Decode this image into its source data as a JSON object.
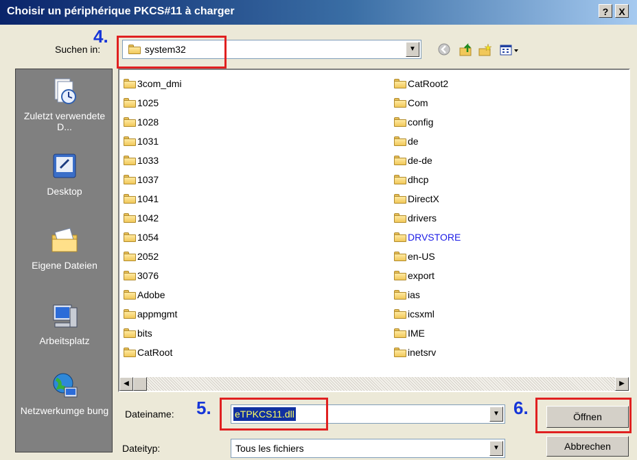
{
  "window": {
    "title": "Choisir un périphérique PKCS#11 à charger",
    "help_button": "?",
    "close_button": "X"
  },
  "lookin": {
    "label": "Suchen in:",
    "value": "system32"
  },
  "steps": {
    "step4": "4.",
    "step5": "5.",
    "step6": "6."
  },
  "toolbar_icons": [
    "back-icon",
    "up-folder-icon",
    "new-folder-icon",
    "view-menu-icon"
  ],
  "places": [
    {
      "label": "Zuletzt verwendete D...",
      "icon": "recent-documents-icon"
    },
    {
      "label": "Desktop",
      "icon": "desktop-icon"
    },
    {
      "label": "Eigene Dateien",
      "icon": "my-documents-icon"
    },
    {
      "label": "Arbeitsplatz",
      "icon": "my-computer-icon"
    },
    {
      "label": "Netzwerkumge bung",
      "icon": "network-places-icon"
    }
  ],
  "files": {
    "col1": [
      "3com_dmi",
      "1025",
      "1028",
      "1031",
      "1033",
      "1037",
      "1041",
      "1042",
      "1054",
      "2052",
      "3076",
      "Adobe",
      "appmgmt",
      "bits",
      "CatRoot"
    ],
    "col2": [
      "CatRoot2",
      "Com",
      "config",
      "de",
      "de-de",
      "dhcp",
      "DirectX",
      "drivers",
      "DRVSTORE",
      "en-US",
      "export",
      "ias",
      "icsxml",
      "IME",
      "inetsrv"
    ],
    "highlighted_item": "DRVSTORE",
    "highlight_color": "#1A1AE6"
  },
  "filename": {
    "label": "Dateiname:",
    "value": "eTPKCS11.dll"
  },
  "filetype": {
    "label": "Dateityp:",
    "value": "Tous les fichiers"
  },
  "buttons": {
    "open": "Öffnen",
    "cancel": "Abbrechen"
  },
  "colors": {
    "annotation_red": "#E02020",
    "annotation_yellow": "#FFFF60",
    "step_blue": "#1535D8"
  }
}
